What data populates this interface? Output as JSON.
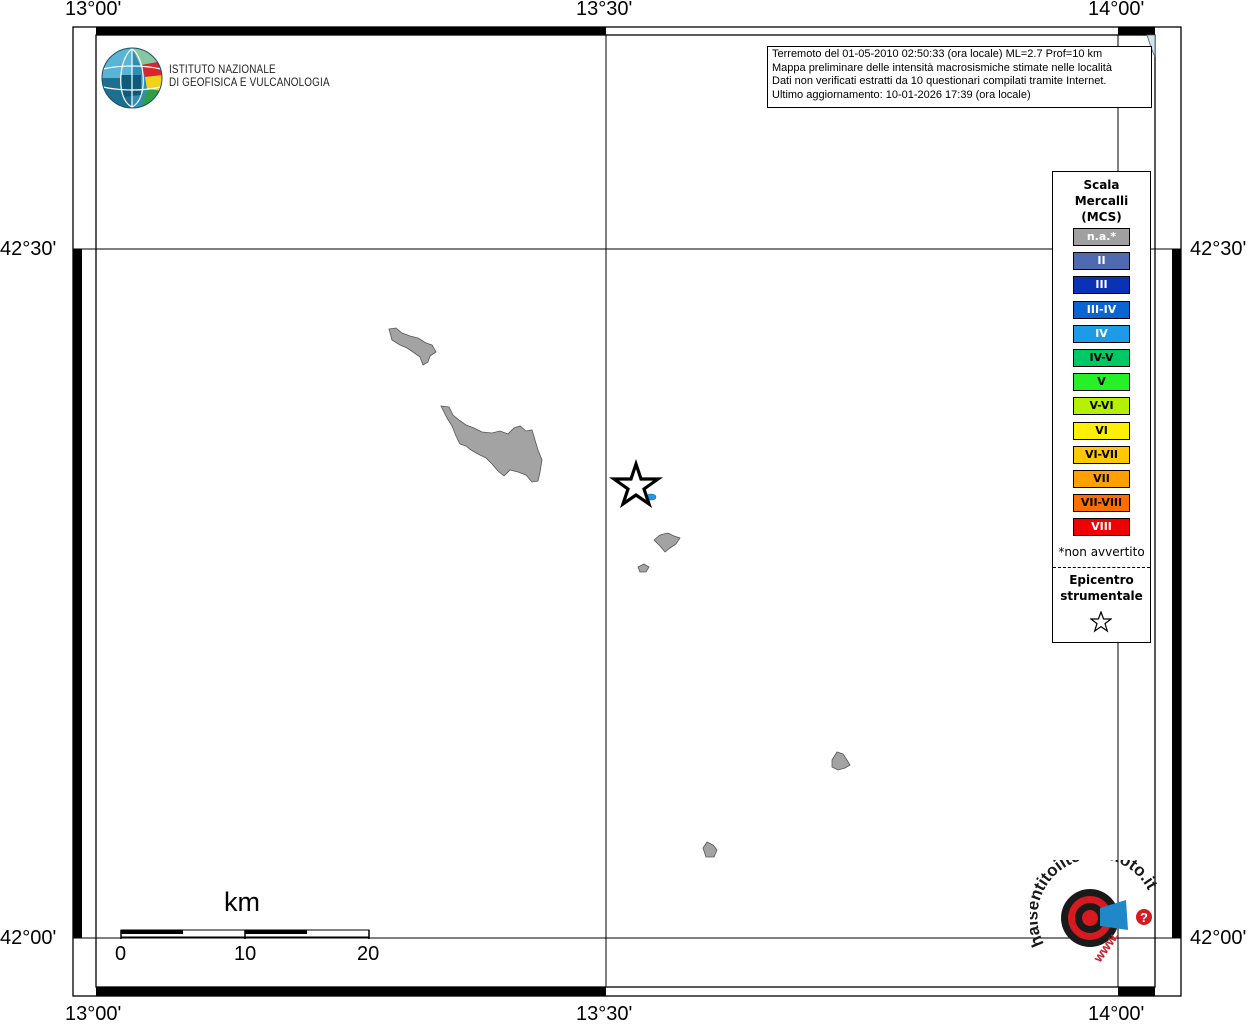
{
  "coordinates": {
    "lon_top": [
      "13°00'",
      "13°30'",
      "14°00'"
    ],
    "lon_bottom": [
      "13°00'",
      "13°30'",
      "14°00'"
    ],
    "lat_left": [
      "42°30'",
      "42°00'"
    ],
    "lat_right": [
      "42°30'",
      "42°00'"
    ]
  },
  "logo": {
    "line1": "ISTITUTO NAZIONALE",
    "line2": "DI GEOFISICA E VULCANOLOGIA"
  },
  "info": {
    "line1": "Terremoto del 01-05-2010 02:50:33 (ora locale) ML=2.7 Prof=10 km",
    "line2": "Mappa preliminare delle intensità macrosismiche stimate nelle località",
    "line3": "Dati non verificati estratti da 10 questionari compilati tramite Internet.",
    "line4": "Ultimo aggiornamento: 10-01-2026 17:39 (ora locale)"
  },
  "legend": {
    "title_line1": "Scala",
    "title_line2": "Mercalli",
    "title_line3": "(MCS)",
    "items": [
      {
        "label": "n.a.*",
        "color": "#a0a0a0",
        "text_color": "#ffffff"
      },
      {
        "label": "II",
        "color": "#4f6ab0",
        "text_color": "#ffffff"
      },
      {
        "label": "III",
        "color": "#0a32b4",
        "text_color": "#ffffff"
      },
      {
        "label": "III-IV",
        "color": "#0a64d2",
        "text_color": "#ffffff"
      },
      {
        "label": "IV",
        "color": "#1e9be6",
        "text_color": "#ffffff"
      },
      {
        "label": "IV-V",
        "color": "#00c864",
        "text_color": "#000000"
      },
      {
        "label": "V",
        "color": "#28f028",
        "text_color": "#000000"
      },
      {
        "label": "V-VI",
        "color": "#b4f000",
        "text_color": "#000000"
      },
      {
        "label": "VI",
        "color": "#fff000",
        "text_color": "#000000"
      },
      {
        "label": "VI-VII",
        "color": "#ffc800",
        "text_color": "#000000"
      },
      {
        "label": "VII",
        "color": "#ffa000",
        "text_color": "#000000"
      },
      {
        "label": "VII-VIII",
        "color": "#ff6e00",
        "text_color": "#000000"
      },
      {
        "label": "VIII",
        "color": "#f00000",
        "text_color": "#ffffff"
      }
    ],
    "note": "*non avvertito",
    "epicenter_line1": "Epicentro",
    "epicenter_line2": "strumentale"
  },
  "scale_bar": {
    "unit": "km",
    "labels": [
      "0",
      "10",
      "20"
    ]
  },
  "watermark": {
    "text": "haisentitoilterremoto.it",
    "url_prefix": "www.",
    "question": "?"
  },
  "reports": [
    {
      "intensity": "IV",
      "color": "#1e9be6"
    }
  ]
}
